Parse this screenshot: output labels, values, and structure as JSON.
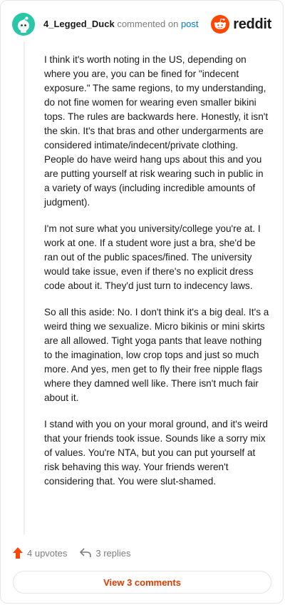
{
  "comment": {
    "username": "4_Legged_Duck",
    "commented_on_text": "commented on",
    "post_link_text": "post",
    "paragraphs": [
      "I think it's worth noting in the US, depending on where you are, you can be fined for \"indecent exposure.\" The same regions, to my understanding, do not fine women for wearing even smaller bikini tops. The rules are backwards here. Honestly, it isn't the skin. It's that bras and other undergarments are considered intimate/indecent/private clothing. People do have weird hang ups about this and you are putting yourself at risk wearing such in public in a variety of ways (including incredible amounts of judgment).",
      "I'm not sure what you university/college you're at. I work at one. If a student wore just a bra, she'd be ran out of the public spaces/fined. The university would take issue, even if there's no explicit dress code about it. They'd just turn to indecency laws.",
      "So all this aside: No. I don't think it's a big deal. It's a weird thing we sexualize. Micro bikinis or mini skirts are all allowed. Tight yoga pants that leave nothing to the imagination, low crop tops and just so much more. And yes, men get to fly their free nipple flags where they damned well like. There isn't much fair about it.",
      "I stand with you on your moral ground, and it's weird that your friends took issue. Sounds like a sorry mix of values. You're NTA, but you can put yourself at risk behaving this way. Your friends weren't considering that. You were slut-shamed."
    ],
    "upvotes_label": "4 upvotes",
    "replies_label": "3 replies",
    "view_comments_label": "View 3 comments"
  },
  "brand": {
    "wordmark": "reddit",
    "accent_color": "#ff4500"
  },
  "avatar": {
    "icon": "snoo-avatar-icon",
    "color": "#29c7a8"
  },
  "colors": {
    "link": "#0079d3",
    "view_button_text": "#d93a00",
    "upvote_icon": "#ff4500"
  }
}
